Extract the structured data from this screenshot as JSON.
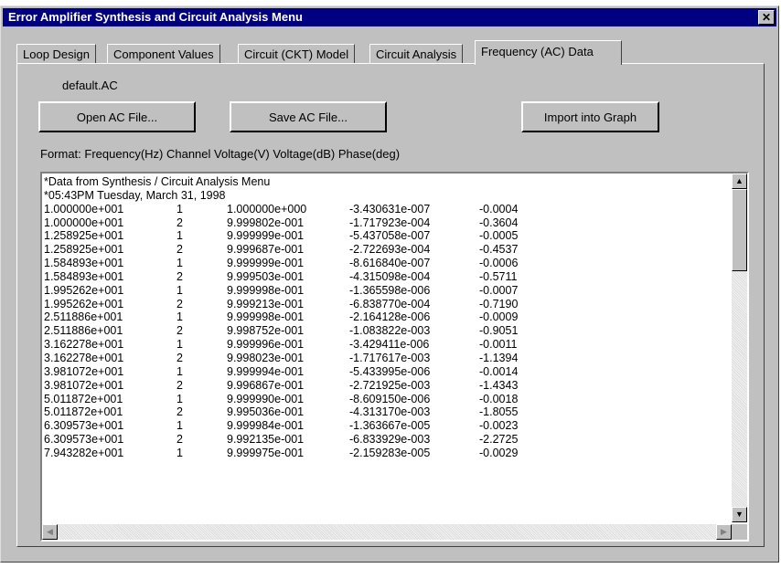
{
  "window": {
    "title": "Error Amplifier Synthesis and Circuit Analysis Menu",
    "close_glyph": "✕"
  },
  "tabs": [
    {
      "label": "Loop Design"
    },
    {
      "label": "Component Values"
    },
    {
      "label": "Circuit (CKT) Model"
    },
    {
      "label": "Circuit Analysis"
    },
    {
      "label": "Frequency (AC) Data"
    }
  ],
  "active_tab": "Frequency (AC) Data",
  "filename": "default.AC",
  "buttons": {
    "open": "Open AC File...",
    "save": "Save AC File...",
    "import": "Import into Graph"
  },
  "format_line": "Format:  Frequency(Hz)  Channel  Voltage(V)  Voltage(dB)  Phase(deg)",
  "listing": {
    "header": [
      "*Data from Synthesis / Circuit Analysis Menu",
      "*05:43PM Tuesday, March 31, 1998"
    ],
    "rows": [
      [
        "1.000000e+001",
        "1",
        "1.000000e+000",
        "-3.430631e-007",
        "-0.0004"
      ],
      [
        "1.000000e+001",
        "2",
        "9.999802e-001",
        "-1.717923e-004",
        "-0.3604"
      ],
      [
        "1.258925e+001",
        "1",
        "9.999999e-001",
        "-5.437058e-007",
        "-0.0005"
      ],
      [
        "1.258925e+001",
        "2",
        "9.999687e-001",
        "-2.722693e-004",
        "-0.4537"
      ],
      [
        "1.584893e+001",
        "1",
        "9.999999e-001",
        "-8.616840e-007",
        "-0.0006"
      ],
      [
        "1.584893e+001",
        "2",
        "9.999503e-001",
        "-4.315098e-004",
        "-0.5711"
      ],
      [
        "1.995262e+001",
        "1",
        "9.999998e-001",
        "-1.365598e-006",
        "-0.0007"
      ],
      [
        "1.995262e+001",
        "2",
        "9.999213e-001",
        "-6.838770e-004",
        "-0.7190"
      ],
      [
        "2.511886e+001",
        "1",
        "9.999998e-001",
        "-2.164128e-006",
        "-0.0009"
      ],
      [
        "2.511886e+001",
        "2",
        "9.998752e-001",
        "-1.083822e-003",
        "-0.9051"
      ],
      [
        "3.162278e+001",
        "1",
        "9.999996e-001",
        "-3.429411e-006",
        "-0.0011"
      ],
      [
        "3.162278e+001",
        "2",
        "9.998023e-001",
        "-1.717617e-003",
        "-1.1394"
      ],
      [
        "3.981072e+001",
        "1",
        "9.999994e-001",
        "-5.433995e-006",
        "-0.0014"
      ],
      [
        "3.981072e+001",
        "2",
        "9.996867e-001",
        "-2.721925e-003",
        "-1.4343"
      ],
      [
        "5.011872e+001",
        "1",
        "9.999990e-001",
        "-8.609150e-006",
        "-0.0018"
      ],
      [
        "5.011872e+001",
        "2",
        "9.995036e-001",
        "-4.313170e-003",
        "-1.8055"
      ],
      [
        "6.309573e+001",
        "1",
        "9.999984e-001",
        "-1.363667e-005",
        "-0.0023"
      ],
      [
        "6.309573e+001",
        "2",
        "9.992135e-001",
        "-6.833929e-003",
        "-2.2725"
      ],
      [
        "7.943282e+001",
        "1",
        "9.999975e-001",
        "-2.159283e-005",
        "-0.0029"
      ]
    ]
  },
  "scroll_glyphs": {
    "up": "▲",
    "down": "▼",
    "left": "◀",
    "right": "▶"
  }
}
